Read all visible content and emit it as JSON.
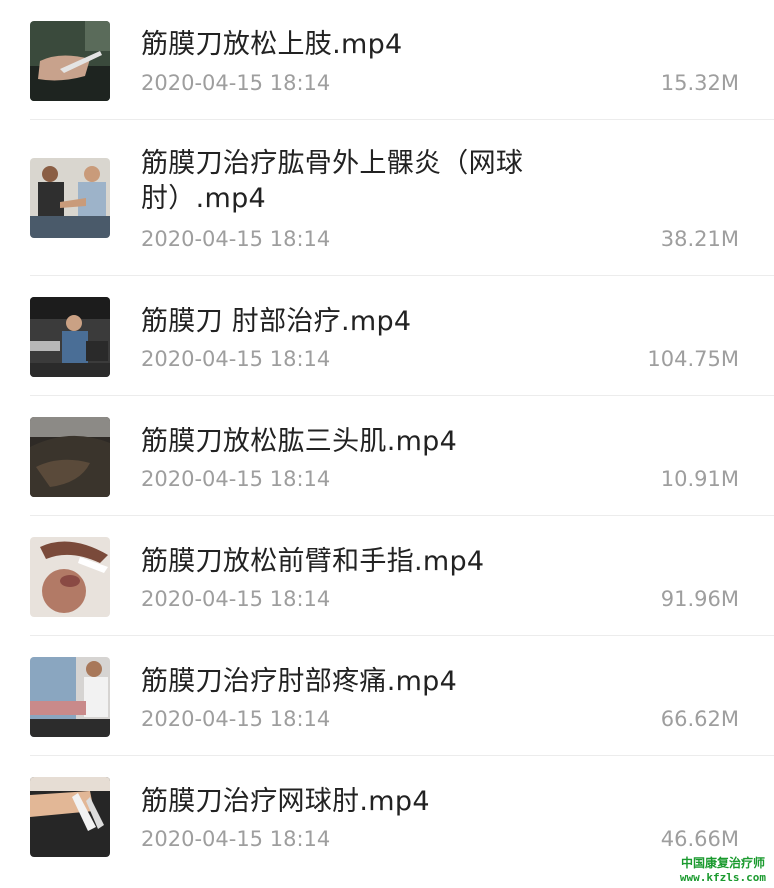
{
  "files": [
    {
      "title": "筋膜刀放松上肢.mp4",
      "date": "2020-04-15 18:14",
      "size": "15.32M",
      "thumb_icon": "video-thumbnail-icon"
    },
    {
      "title": "筋膜刀治疗肱骨外上髁炎（网球肘）.mp4",
      "date": "2020-04-15 18:14",
      "size": "38.21M",
      "thumb_icon": "video-thumbnail-icon"
    },
    {
      "title": "筋膜刀 肘部治疗.mp4",
      "date": "2020-04-15 18:14",
      "size": "104.75M",
      "thumb_icon": "video-thumbnail-icon"
    },
    {
      "title": "筋膜刀放松肱三头肌.mp4",
      "date": "2020-04-15 18:14",
      "size": "10.91M",
      "thumb_icon": "video-thumbnail-icon"
    },
    {
      "title": "筋膜刀放松前臂和手指.mp4",
      "date": "2020-04-15 18:14",
      "size": "91.96M",
      "thumb_icon": "video-thumbnail-icon"
    },
    {
      "title": "筋膜刀治疗肘部疼痛.mp4",
      "date": "2020-04-15 18:14",
      "size": "66.62M",
      "thumb_icon": "video-thumbnail-icon"
    },
    {
      "title": "筋膜刀治疗网球肘.mp4",
      "date": "2020-04-15 18:14",
      "size": "46.66M",
      "thumb_icon": "video-thumbnail-icon"
    }
  ],
  "watermark": {
    "line1": "中国康复治疗师",
    "line2": "www.kfzls.com"
  }
}
